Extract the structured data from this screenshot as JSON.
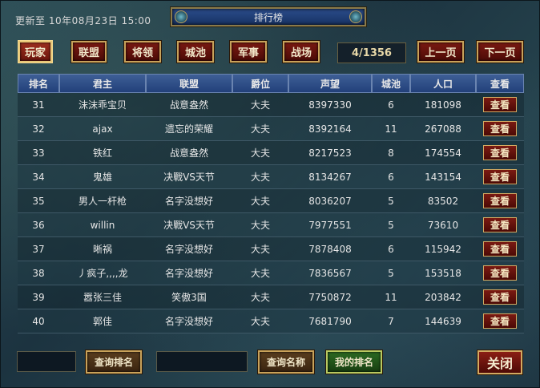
{
  "header": {
    "update_prefix": "更新至",
    "update_time": "10年08月23日 15:00",
    "title": "排行榜"
  },
  "categories": [
    {
      "label": "玩家",
      "active": true
    },
    {
      "label": "联盟",
      "active": false
    },
    {
      "label": "将领",
      "active": false
    },
    {
      "label": "城池",
      "active": false
    },
    {
      "label": "军事",
      "active": false
    },
    {
      "label": "战场",
      "active": false
    }
  ],
  "pagination": {
    "indicator": "4/1356",
    "prev_label": "上一页",
    "next_label": "下一页"
  },
  "table": {
    "columns": [
      "排名",
      "君主",
      "联盟",
      "爵位",
      "声望",
      "城池",
      "人口",
      "查看"
    ],
    "view_label": "查看",
    "rows": [
      [
        "31",
        "沫沫乖宝贝",
        "战意盎然",
        "大夫",
        "8397330",
        "6",
        "181098"
      ],
      [
        "32",
        "ajax",
        "遗忘的荣耀",
        "大夫",
        "8392164",
        "11",
        "267088"
      ],
      [
        "33",
        "铁红",
        "战意盎然",
        "大夫",
        "8217523",
        "8",
        "174554"
      ],
      [
        "34",
        "鬼雄",
        "决戰VS天节",
        "大夫",
        "8134267",
        "6",
        "143154"
      ],
      [
        "35",
        "男人一杆枪",
        "名字没想好",
        "大夫",
        "8036207",
        "5",
        "83502"
      ],
      [
        "36",
        "willin",
        "决戰VS天节",
        "大夫",
        "7977551",
        "5",
        "73610"
      ],
      [
        "37",
        "晰祸",
        "名字没想好",
        "大夫",
        "7878408",
        "6",
        "115942"
      ],
      [
        "38",
        "丿疯子,,,,龙",
        "名字没想好",
        "大夫",
        "7836567",
        "5",
        "153518"
      ],
      [
        "39",
        "嚣张三佳",
        "笑傲3国",
        "大夫",
        "7750872",
        "11",
        "203842"
      ],
      [
        "40",
        "郭佳",
        "名字没想好",
        "大夫",
        "7681790",
        "7",
        "144639"
      ]
    ]
  },
  "footer": {
    "rank_search_value": "",
    "search_rank_label": "查询排名",
    "name_search_value": "",
    "search_name_label": "查询名称",
    "my_rank_label": "我的排名",
    "close_label": "关闭"
  }
}
